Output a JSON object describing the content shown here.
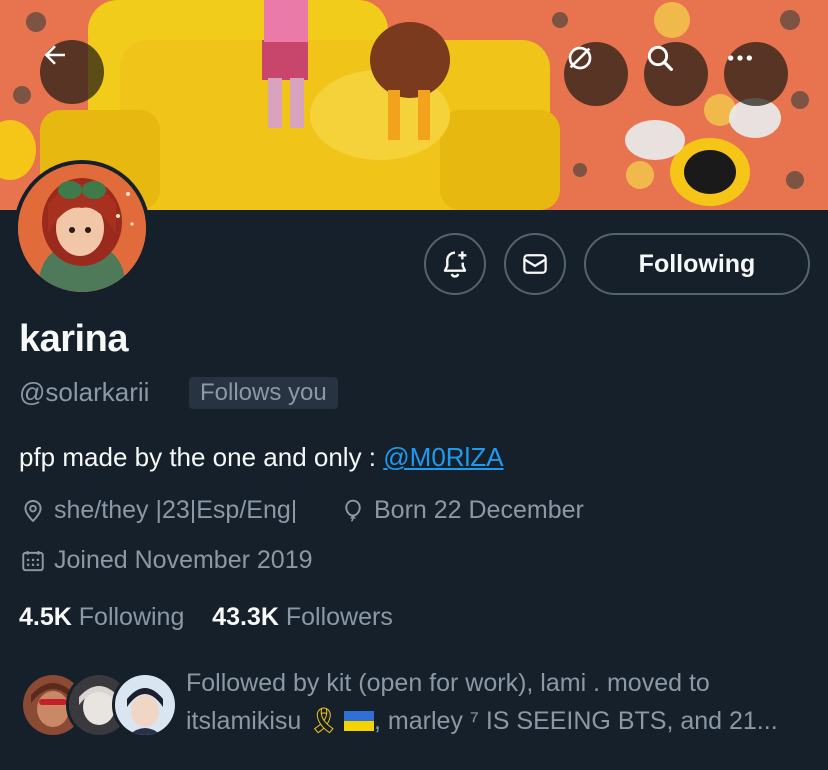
{
  "profile": {
    "display_name": "karina",
    "handle": "@solarkarii",
    "follows_you": "Follows you",
    "bio_text": "pfp made by the one and only : ",
    "bio_mention": "@M0RlZA",
    "pronouns_location": "she/they |23|Esp/Eng|",
    "birthday": "Born 22 December",
    "joined": "Joined November 2019"
  },
  "stats": {
    "following_count": "4.5K",
    "following_label": "Following",
    "followers_count": "43.3K",
    "followers_label": "Followers"
  },
  "actions": {
    "following_button": "Following"
  },
  "followed_by": {
    "line1": "Followed by kit (open for work), lami . moved to",
    "line2_prefix": "itslamikisu ",
    "ribbon": "🎗",
    "line2_suffix": ", marley ⁷ IS SEEING BTS, and 21..."
  },
  "icons": {
    "back": "arrow-left-icon",
    "grok": "grok-icon",
    "search": "search-icon",
    "more": "more-icon",
    "notify": "bell-plus-icon",
    "message": "envelope-icon",
    "location": "location-pin-icon",
    "birthday": "balloon-icon",
    "calendar": "calendar-icon"
  },
  "colors": {
    "background": "#15202b",
    "accent": "#1d9bf0",
    "secondary_text": "#8b98a5",
    "border": "#536471"
  }
}
